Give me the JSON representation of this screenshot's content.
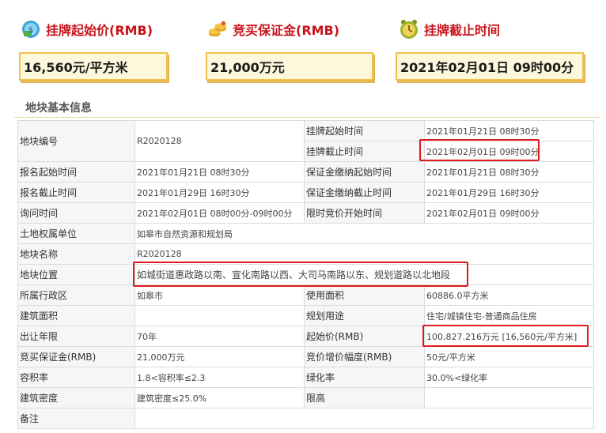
{
  "header": {
    "start_price_title": "挂牌起始价(RMB)",
    "start_price_value": "16,560元/平方米",
    "deposit_title": "竞买保证金(RMB)",
    "deposit_value": "21,000万元",
    "deadline_title": "挂牌截止时间",
    "deadline_value": "2021年02月01日  09时00分",
    "icons": [
      "money-icon",
      "coins-icon",
      "alarm-clock-icon"
    ]
  },
  "section": {
    "title": "地块基本信息"
  },
  "table": {
    "r1": {
      "l1": "地块编号",
      "v1": "R2020128",
      "l2": "挂牌起始时间",
      "v2": "2021年01月21日 08时30分"
    },
    "r2": {
      "l2": "挂牌截止时间",
      "v2": "2021年02月01日 09时00分"
    },
    "r3": {
      "l1": "报名起始时间",
      "v1": "2021年01月21日 08时30分",
      "l2": "保证金缴纳起始时间",
      "v2": "2021年01月21日 08时30分"
    },
    "r4": {
      "l1": "报名截止时间",
      "v1": "2021年01月29日 16时30分",
      "l2": "保证金缴纳截止时间",
      "v2": "2021年01月29日 16时30分"
    },
    "r5": {
      "l1": "询问时间",
      "v1": "2021年02月01日 08时00分-09时00分",
      "l2": "限时竞价开始时间",
      "v2": "2021年02月01日 09时00分"
    },
    "r6": {
      "l1": "土地权属单位",
      "v1": "如皋市自然资源和规划局"
    },
    "r7": {
      "l1": "地块名称",
      "v1": "R2020128"
    },
    "r8": {
      "l1": "地块位置",
      "v1": "如城街道惠政路以南、宣化南路以西、大司马南路以东、规划道路以北地段"
    },
    "r9": {
      "l1": "所属行政区",
      "v1": "如皋市",
      "l2": "使用面积",
      "v2": "60886.0平方米"
    },
    "r10": {
      "l1": "建筑面积",
      "v1": "",
      "l2": "规划用途",
      "v2": "住宅/城镇住宅-普通商品住房"
    },
    "r11": {
      "l1": "出让年限",
      "v1": "70年",
      "l2": "起始价(RMB)",
      "v2": "100,827.216万元 [16,560元/平方米]"
    },
    "r12": {
      "l1": "竞买保证金(RMB)",
      "v1": "21,000万元",
      "l2": "竞价增价幅度(RMB)",
      "v2": "50元/平方米"
    },
    "r13": {
      "l1": "容积率",
      "v1": "1.8<容积率≤2.3",
      "l2": "绿化率",
      "v2": "30.0%<绿化率"
    },
    "r14": {
      "l1": "建筑密度",
      "v1": "建筑密度≤25.0%",
      "l2": "限高",
      "v2": ""
    },
    "r15": {
      "l1": "备注",
      "v1": ""
    }
  },
  "colors": {
    "accent_red": "#c8141c",
    "box_border": "#efc04b",
    "box_fill": "#fdf8dc",
    "highlight": "#e01a1a"
  }
}
